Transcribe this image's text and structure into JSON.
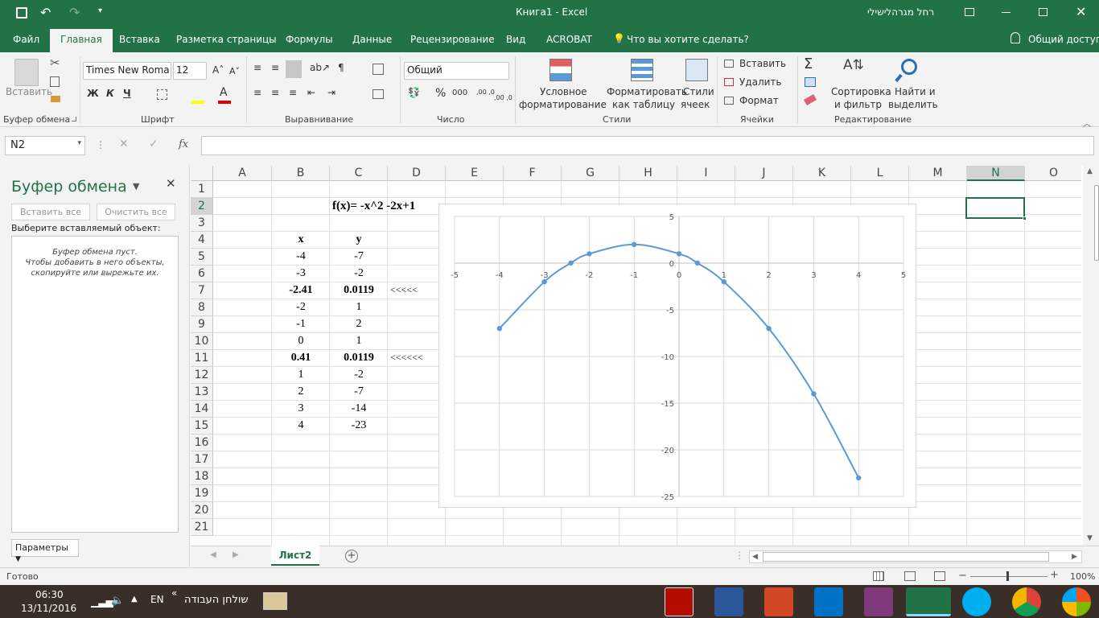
{
  "titlebar": {
    "doc_title": "Книга1  -  Excel",
    "user": "רחל מגרהלישילי"
  },
  "tabs": [
    "Файл",
    "Главная",
    "Вставка",
    "Разметка страницы",
    "Формулы",
    "Данные",
    "Рецензирование",
    "Вид",
    "ACROBAT"
  ],
  "tellme": "Что вы хотите сделать?",
  "share": "Общий доступ",
  "ribbon": {
    "paste": "Вставить",
    "font_name": "Times New Roma",
    "font_size": "12",
    "bold": "Ж",
    "italic": "К",
    "underline": "Ч",
    "number_format": "Общий",
    "cond_fmt_1": "Условное",
    "cond_fmt_2": "форматирование",
    "fmt_table_1": "Форматировать",
    "fmt_table_2": "как таблицу",
    "cell_styles_1": "Стили",
    "cell_styles_2": "ячеек",
    "insert": "Вставить",
    "delete": "Удалить",
    "format": "Формат",
    "sort_1": "Сортировка",
    "sort_2": "и фильтр",
    "find_1": "Найти и",
    "find_2": "выделить",
    "percent": "%",
    "thousands": "000",
    "dec_inc": ",00 ,0",
    "dec_dec": ",00 ,0",
    "groups": {
      "clipboard": "Буфер обмена",
      "font": "Шрифт",
      "align": "Выравнивание",
      "number": "Число",
      "styles": "Стили",
      "cells": "Ячейки",
      "edit": "Редактирование"
    }
  },
  "formula_bar": {
    "name_box": "N2",
    "fx": "fx",
    "formula": ""
  },
  "pane": {
    "title": "Буфер обмена",
    "paste_all": "Вставить все",
    "clear_all": "Очистить все",
    "choose": "Выберите вставляемый объект:",
    "empty_1": "Буфер обмена пуст.",
    "empty_2": "Чтобы добавить в него объекты,",
    "empty_3": "скопируйте или вырежьте их.",
    "options": "Параметры"
  },
  "columns": [
    "A",
    "B",
    "C",
    "D",
    "E",
    "F",
    "G",
    "H",
    "I",
    "J",
    "K",
    "L",
    "M",
    "N",
    "O"
  ],
  "rows": [
    "1",
    "2",
    "3",
    "4",
    "5",
    "6",
    "7",
    "8",
    "9",
    "10",
    "11",
    "12",
    "13",
    "14",
    "15",
    "16",
    "17",
    "18",
    "19",
    "20",
    "21"
  ],
  "cells": {
    "formula_title": "f(x)= -x^2 -2x+1",
    "hdr_x": "x",
    "hdr_y": "y",
    "b": [
      "-4",
      "-3",
      "-2.41",
      "-2",
      "-1",
      "0",
      "0.41",
      "1",
      "2",
      "3",
      "4"
    ],
    "c": [
      "-7",
      "-2",
      "0.0119",
      "1",
      "2",
      "1",
      "0.0119",
      "-2",
      "-7",
      "-14",
      "-23"
    ],
    "d7": "<<<<<",
    "d11": "<<<<<<"
  },
  "chart_data": {
    "type": "scatter",
    "series": [
      {
        "x": [
          -4,
          -3,
          -2.41,
          -2,
          -1,
          0,
          0.41,
          1,
          2,
          3,
          4
        ],
        "values": [
          -7,
          -2,
          0.0119,
          1,
          2,
          1,
          0.0119,
          -2,
          -7,
          -14,
          -23
        ]
      }
    ],
    "xlim": [
      -5,
      5
    ],
    "ylim": [
      -25,
      5
    ],
    "xticks": [
      "-5",
      "-4",
      "-3",
      "-2",
      "-1",
      "0",
      "1",
      "2",
      "3",
      "4",
      "5"
    ],
    "yticks": [
      "5",
      "0",
      "-5",
      "-10",
      "-15",
      "-20",
      "-25"
    ],
    "grid": true,
    "color": "#5b9bd5"
  },
  "sheet_tab": "Лист2",
  "status": {
    "ready": "Готово",
    "zoom": "100%"
  },
  "taskbar": {
    "time": "06:30",
    "date": "13/11/2016",
    "lang": "EN",
    "desktop": "שולחן העבודה"
  }
}
